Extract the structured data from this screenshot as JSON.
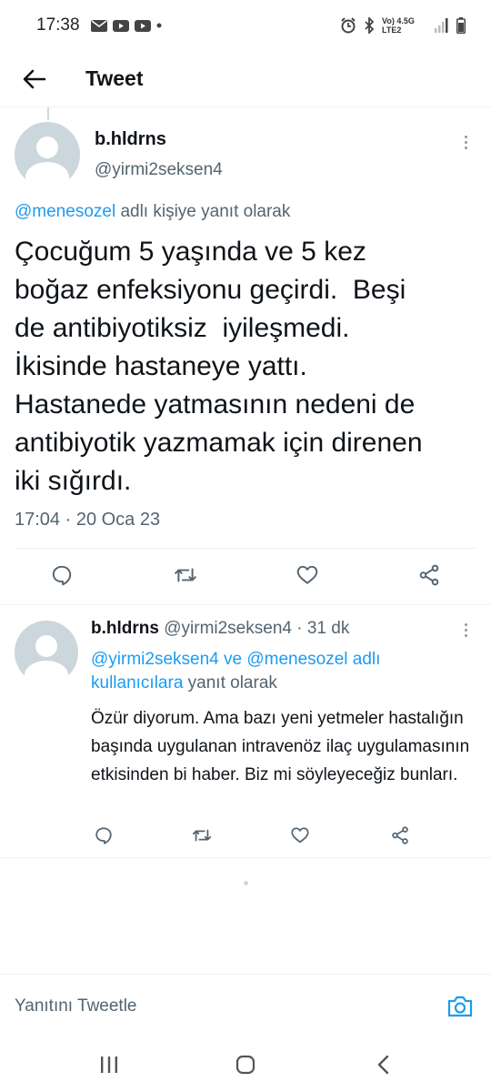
{
  "status_bar": {
    "time": "17:38",
    "network_label": "Vo) 4.5G LTE2",
    "battery_icon": "battery-icon"
  },
  "header": {
    "title": "Tweet",
    "back_icon": "arrow-left-icon"
  },
  "main_tweet": {
    "name": "b.hldrns",
    "handle": "@yirmi2seksen4",
    "reply_to_mention": "@menesozel",
    "reply_to_suffix": " adlı kişiye yanıt olarak",
    "text": "Çocuğum 5 yaşında ve 5 kez\nboğaz enfeksiyonu geçirdi.  Beşi\nde antibiyotiksiz  iyileşmedi.\nİkisinde hastaneye yattı.\nHastanede yatmasının nedeni de\nantibiyotik yazmamak için direnen\niki sığırdı.",
    "timestamp": "17:04 · 20 Oca 23",
    "actions": [
      "reply-icon",
      "retweet-icon",
      "like-icon",
      "share-icon"
    ]
  },
  "reply_tweet": {
    "name": "b.hldrns",
    "handle": "@yirmi2seksen4",
    "time_ago": "· 31 dk",
    "reply_mention_1": "@yirmi2seksen4",
    "reply_connector": " ve ",
    "reply_mention_2": "@menesozel",
    "reply_mid": " adlı",
    "reply_mention_3": "kullanıcılara",
    "reply_suffix": " yanıt olarak",
    "text": "Özür diyorum. Ama bazı yeni yetmeler hastalığın başında uygulanan intravenöz ilaç uygulamasının etkisinden bi haber. Biz mi söyleyeceğiz bunları."
  },
  "composer": {
    "placeholder": "Yanıtını Tweetle",
    "camera_icon": "camera-icon"
  },
  "navigation": [
    "recents-icon",
    "home-icon",
    "back-icon"
  ],
  "colors": {
    "accent": "#1d9bf0",
    "secondary_text": "#536471",
    "divider": "#eff3f4"
  }
}
